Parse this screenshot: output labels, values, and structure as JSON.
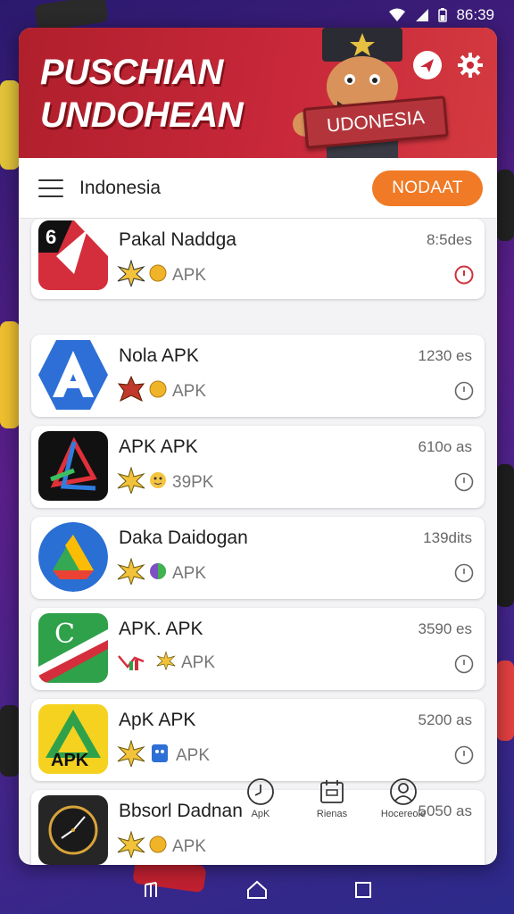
{
  "status_bar": {
    "time": "86:39"
  },
  "banner": {
    "title_line1": "PUSCHIAN",
    "title_line2": "UNDOHEAN",
    "sign_text": "UDONESIA"
  },
  "toolbar": {
    "region": "Indonesia",
    "cta_label": "NODAAT"
  },
  "apps": [
    {
      "name": "Pakal Naddga",
      "sub": "APK",
      "size": "8:5des",
      "accent": "#d0313b"
    },
    {
      "name": "Nola APK",
      "sub": "APK",
      "size": "1230 es",
      "accent": "#555555"
    },
    {
      "name": "APK APK",
      "sub": "39PK",
      "size": "610o as",
      "accent": "#555555"
    },
    {
      "name": "Daka Daidogan",
      "sub": "APK",
      "size": "139dits",
      "accent": "#555555"
    },
    {
      "name": "APK. APK",
      "sub": "APK",
      "size": "3590 es",
      "accent": "#555555"
    },
    {
      "name": "ApK APK",
      "sub": "APK",
      "size": "5200 as",
      "accent": "#555555"
    },
    {
      "name": "Bbsorl Dadnan",
      "sub": "APK",
      "size": "5050 as",
      "accent": "#555555"
    }
  ],
  "bottom_tabs": [
    {
      "label": "ApK",
      "icon": "clock-icon"
    },
    {
      "label": "Rienas",
      "icon": "calendar-icon"
    },
    {
      "label": "Hocereole",
      "icon": "profile-icon"
    }
  ],
  "icon_6_label": "6",
  "icon_c_label": "C",
  "icon_apk_label": "APK",
  "colors": {
    "banner_red": "#c8283a",
    "cta_orange": "#f07a25"
  }
}
